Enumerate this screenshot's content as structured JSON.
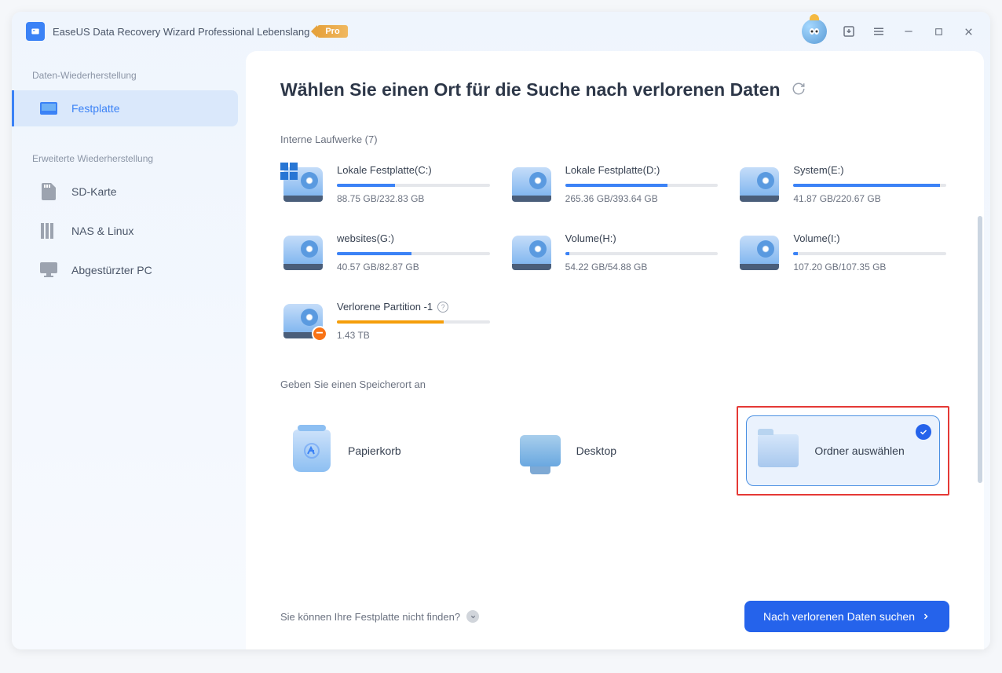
{
  "header": {
    "app_title": "EaseUS Data Recovery Wizard Professional Lebenslang",
    "pro_label": "Pro"
  },
  "sidebar": {
    "section1_label": "Daten-Wiederherstellung",
    "section2_label": "Erweiterte Wiederherstellung",
    "items": {
      "festplatte": "Festplatte",
      "sd_karte": "SD-Karte",
      "nas_linux": "NAS & Linux",
      "crashed_pc": "Abgestürzter PC"
    }
  },
  "main": {
    "page_title": "Wählen Sie einen Ort für die Suche nach verlorenen Daten",
    "internal_drives_label": "Interne Laufwerke (7)",
    "drives": [
      {
        "name": "Lokale Festplatte(C:)",
        "size": "88.75 GB/232.83 GB",
        "pct": 38,
        "has_tiles": true
      },
      {
        "name": "Lokale Festplatte(D:)",
        "size": "265.36 GB/393.64 GB",
        "pct": 67
      },
      {
        "name": "System(E:)",
        "size": "41.87 GB/220.67 GB",
        "pct": 96
      },
      {
        "name": "websites(G:)",
        "size": "40.57 GB/82.87 GB",
        "pct": 49
      },
      {
        "name": "Volume(H:)",
        "size": "54.22 GB/54.88 GB",
        "pct": 3
      },
      {
        "name": "Volume(I:)",
        "size": "107.20 GB/107.35 GB",
        "pct": 3
      },
      {
        "name": "Verlorene Partition -1",
        "size": "1.43 TB",
        "pct": 70,
        "lost": true,
        "help": true
      }
    ],
    "location_label": "Geben Sie einen Speicherort an",
    "locations": {
      "recycle": "Papierkorb",
      "desktop": "Desktop",
      "folder": "Ordner auswählen"
    },
    "find_disk_link": "Sie können Ihre Festplatte nicht finden?",
    "search_button": "Nach verlorenen Daten suchen"
  }
}
